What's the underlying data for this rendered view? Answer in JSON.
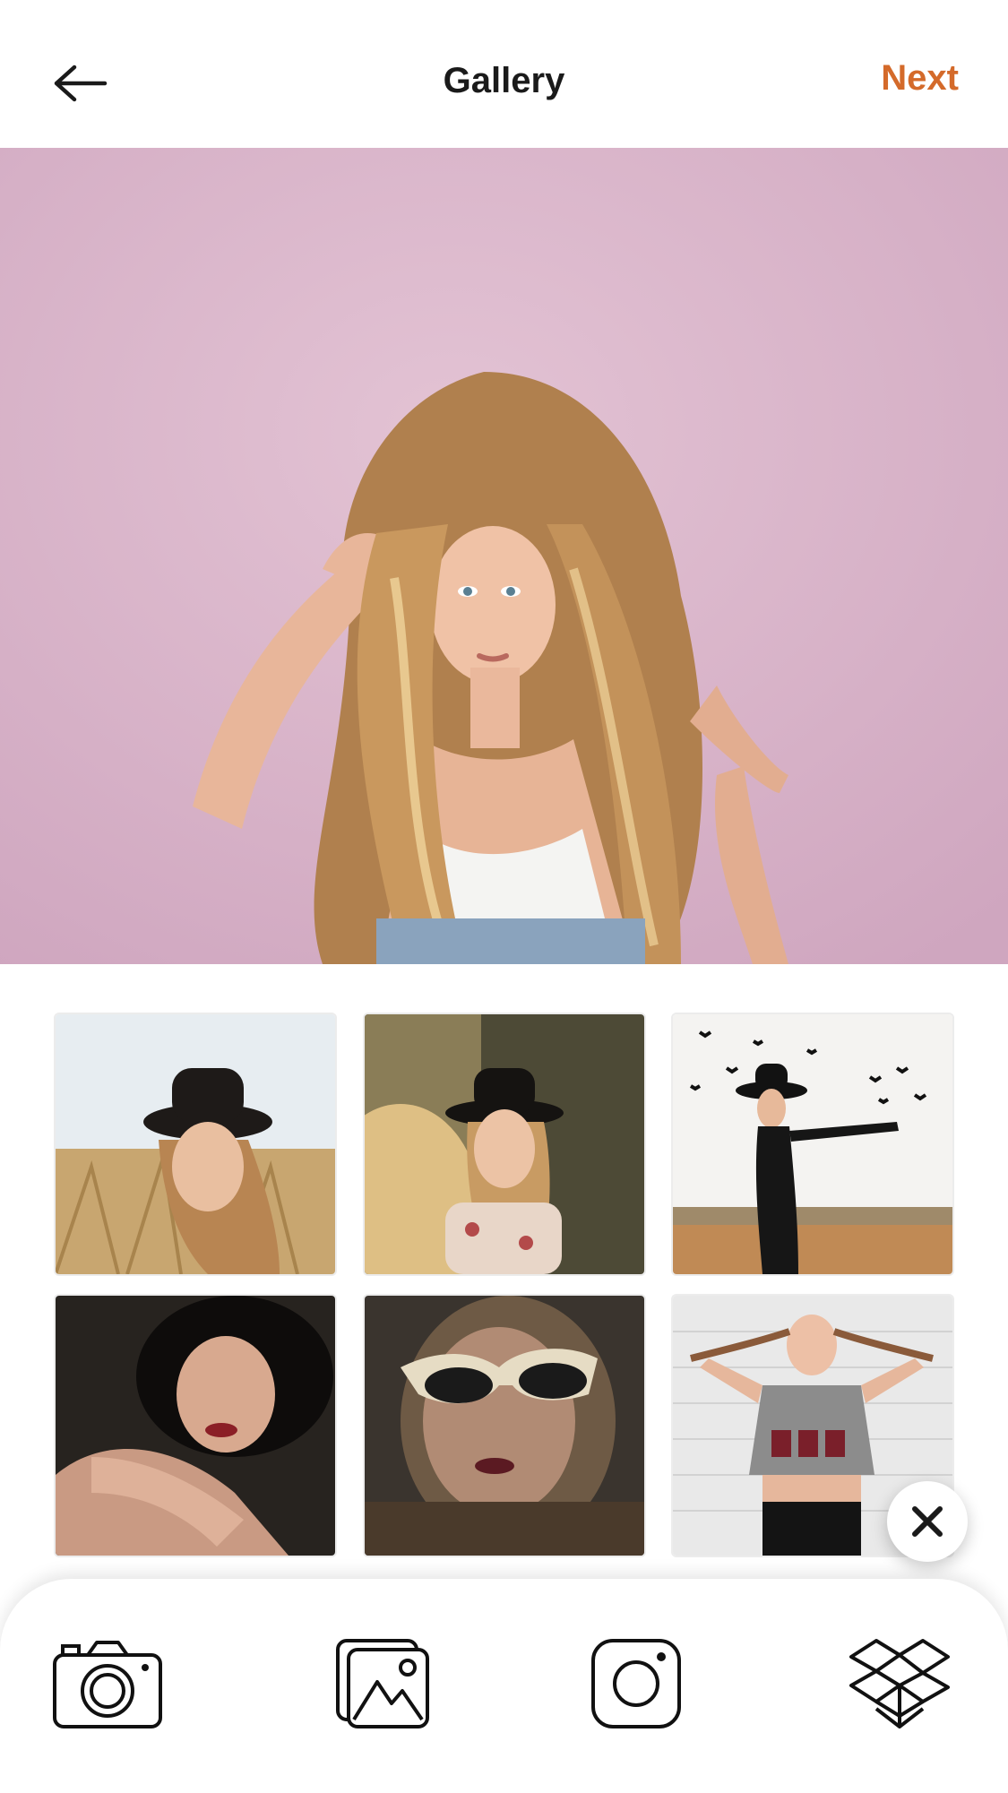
{
  "header": {
    "title": "Gallery",
    "next_label": "Next",
    "accent_color": "#d46a2a"
  },
  "icons": {
    "back": "arrow-left-icon",
    "close": "close-icon",
    "camera": "camera-icon",
    "gallery": "gallery-icon",
    "instagram": "instagram-icon",
    "dropbox": "dropbox-icon"
  },
  "preview": {
    "background_color": "#d8b3c8"
  },
  "gallery": {
    "items": [
      {
        "palette": [
          "#e9eef2",
          "#c9a77a",
          "#1f1a18"
        ]
      },
      {
        "palette": [
          "#6c6b4b",
          "#e8c58f",
          "#1b1915"
        ]
      },
      {
        "palette": [
          "#f2f2f2",
          "#c9935e",
          "#101010"
        ]
      },
      {
        "palette": [
          "#2a2625",
          "#caa08c",
          "#0e0c0c"
        ]
      },
      {
        "palette": [
          "#3a332c",
          "#7a6a57",
          "#141210"
        ]
      },
      {
        "palette": [
          "#e8e8e8",
          "#8b8b8b",
          "#1a1a1a"
        ]
      }
    ]
  }
}
